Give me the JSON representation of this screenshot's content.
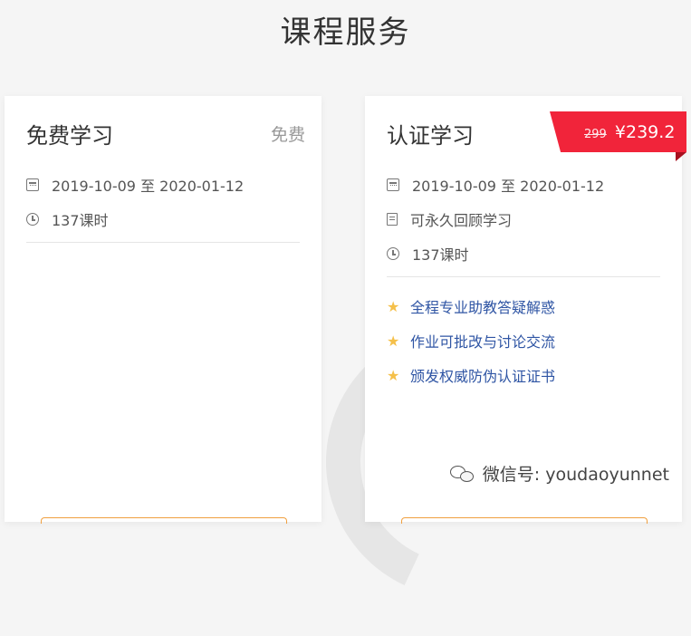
{
  "section_title": "课程服务",
  "free_card": {
    "title": "免费学习",
    "price_label": "免费",
    "date_range": "2019-10-09 至 2020-01-12",
    "hours": "137课时"
  },
  "cert_card": {
    "title": "认证学习",
    "original_price": "299",
    "price": "¥239.2",
    "date_range": "2019-10-09 至 2020-01-12",
    "review": "可永久回顾学习",
    "hours": "137课时",
    "features": [
      "全程专业助教答疑解惑",
      "作业可批改与讨论交流",
      "颁发权威防伪认证证书"
    ]
  },
  "watermark": "微信号: youdaoyunnet",
  "colors": {
    "ribbon": "#f1243a",
    "feature_text": "#2f55a4",
    "star": "#f5c04a"
  }
}
